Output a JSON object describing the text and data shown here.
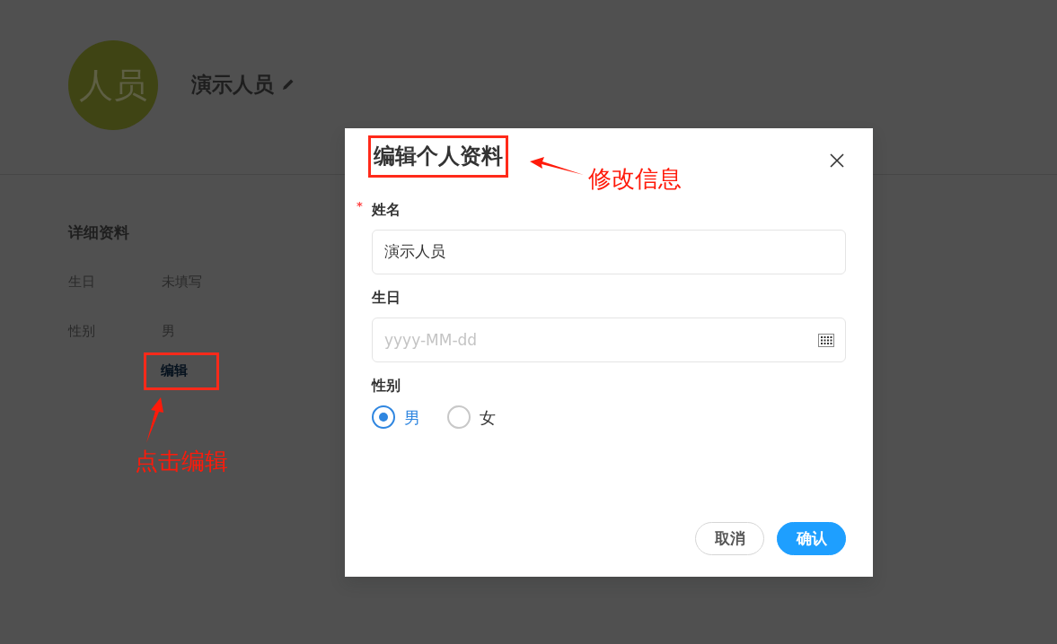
{
  "profile": {
    "avatar_text": "人员",
    "name": "演示人员"
  },
  "details": {
    "title": "详细资料",
    "fields": [
      {
        "label": "生日",
        "value": "未填写"
      },
      {
        "label": "性别",
        "value": "男"
      }
    ],
    "edit_link": "编辑"
  },
  "dialog": {
    "title": "编辑个人资料",
    "fields": [
      {
        "kind": "text",
        "label": "姓名",
        "required_mark": "*",
        "value": "演示人员"
      },
      {
        "kind": "date",
        "label": "生日",
        "placeholder": "yyyy-MM-dd"
      },
      {
        "kind": "radio",
        "label": "性别",
        "options": [
          {
            "label": "男",
            "selected": true
          },
          {
            "label": "女",
            "selected": false
          }
        ]
      }
    ],
    "buttons": [
      {
        "label": "取消",
        "kind": "secondary"
      },
      {
        "label": "确认",
        "kind": "primary"
      }
    ]
  },
  "annotations": [
    {
      "text": "修改信息"
    },
    {
      "text": "点击编辑"
    }
  ]
}
